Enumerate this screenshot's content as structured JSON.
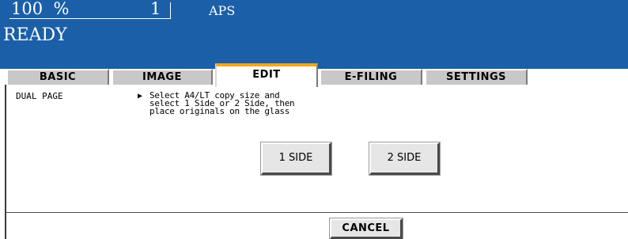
{
  "status": {
    "zoom_value": "100",
    "zoom_unit": "%",
    "copies": "1",
    "paper": "APS",
    "machine_state": "READY"
  },
  "tabs": {
    "basic": "BASIC",
    "image": "IMAGE",
    "edit": "EDIT",
    "efiling": "E-FILING",
    "settings": "SETTINGS",
    "active": "EDIT"
  },
  "edit_panel": {
    "function_name": "DUAL PAGE",
    "instruction_lines": [
      "Select A4/LT copy size and",
      "select 1 Side or 2 Side, then",
      "place originals on the glass"
    ],
    "one_side_label": "1 SIDE",
    "two_side_label": "2 SIDE",
    "cancel_label": "CANCEL"
  },
  "colors": {
    "status_background": "#1b5fa8",
    "active_tab_accent": "#f0a81e"
  }
}
